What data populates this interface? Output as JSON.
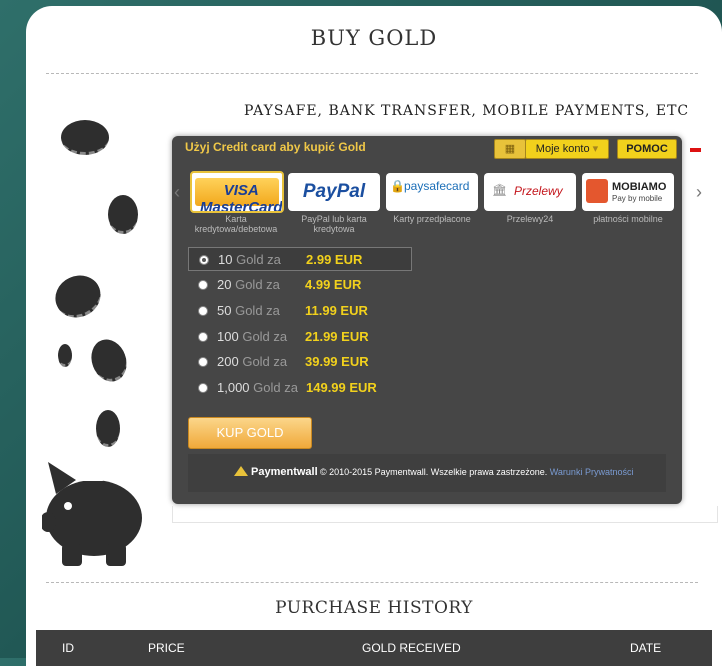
{
  "page": {
    "title": "BUY GOLD",
    "subtitle": "PAYSAFE, BANK TRANSFER, MOBILE PAYMENTS, ETC"
  },
  "widget": {
    "header": "Użyj Credit card aby kupić Gold",
    "account_label": "Moje konto",
    "help_label": "POMOC",
    "methods": [
      {
        "logo": "VISA MasterCard",
        "caption": "Karta kredytowa/debetowa"
      },
      {
        "logo": "PayPal",
        "caption": "PayPal lub karta kredytowa"
      },
      {
        "logo": "paysafecard",
        "caption": "Karty przedpłacone"
      },
      {
        "logo": "Przelewy",
        "caption": "Przelewy24"
      },
      {
        "logo": "MOBIAMO",
        "logo_sub": "Pay by mobile",
        "caption": "płatności mobilne"
      }
    ],
    "options": [
      {
        "amount": "10",
        "unit": "Gold za",
        "price": "2.99 EUR"
      },
      {
        "amount": "20",
        "unit": "Gold za",
        "price": "4.99 EUR"
      },
      {
        "amount": "50",
        "unit": "Gold za",
        "price": "11.99 EUR"
      },
      {
        "amount": "100",
        "unit": "Gold za",
        "price": "21.99 EUR"
      },
      {
        "amount": "200",
        "unit": "Gold za",
        "price": "39.99 EUR"
      },
      {
        "amount": "1,000",
        "unit": "Gold za",
        "price": "149.99 EUR"
      }
    ],
    "buy_label": "KUP GOLD",
    "footer_brand": "Paymentwall",
    "copyright": "© 2010-2015 Paymentwall. Wszelkie prawa zastrzeżone.",
    "privacy": "Warunki Prywatności"
  },
  "history": {
    "title": "PURCHASE HISTORY",
    "columns": [
      "ID",
      "PRICE",
      "GOLD RECEIVED",
      "DATE"
    ]
  },
  "colors": {
    "accent": "#f2d11c",
    "panel": "#464646",
    "background": "#2f6f6a"
  }
}
